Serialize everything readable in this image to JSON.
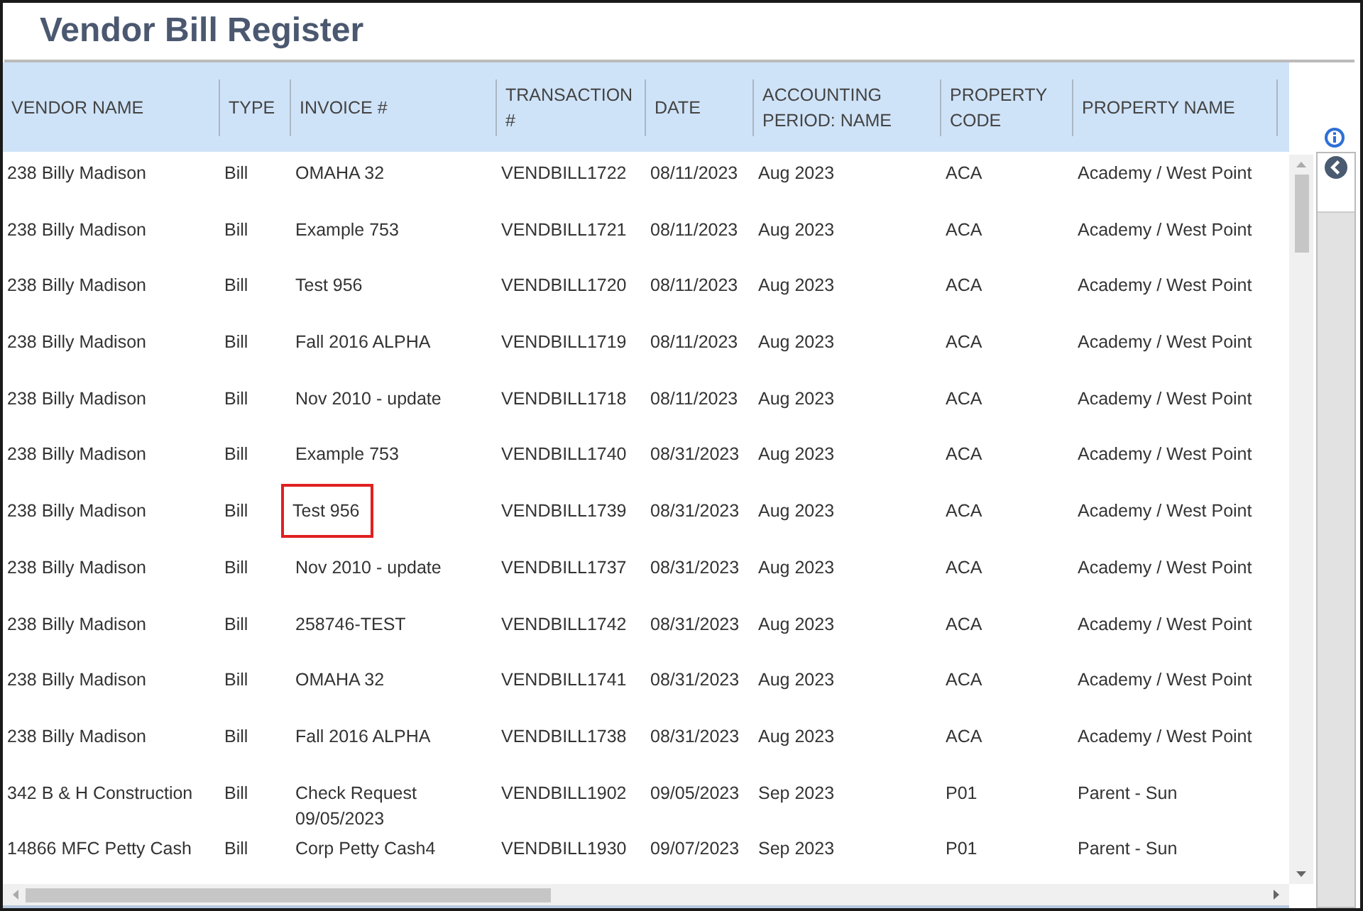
{
  "title": "Vendor Bill Register",
  "columns": [
    "VENDOR NAME",
    "TYPE",
    "INVOICE #",
    "TRANSACTION #",
    "DATE",
    "ACCOUNTING PERIOD: NAME",
    "PROPERTY CODE",
    "PROPERTY NAME"
  ],
  "rows": [
    {
      "cells": [
        "238 Billy Madison",
        "Bill",
        "OMAHA 32",
        "VENDBILL1722",
        "08/11/2023",
        "Aug 2023",
        "ACA",
        "Academy / West Point"
      ],
      "marked": false
    },
    {
      "cells": [
        "238 Billy Madison",
        "Bill",
        "Example 753",
        "VENDBILL1721",
        "08/11/2023",
        "Aug 2023",
        "ACA",
        "Academy / West Point"
      ],
      "marked": false
    },
    {
      "cells": [
        "238 Billy Madison",
        "Bill",
        "Test 956",
        "VENDBILL1720",
        "08/11/2023",
        "Aug 2023",
        "ACA",
        "Academy / West Point"
      ],
      "marked": false
    },
    {
      "cells": [
        "238 Billy Madison",
        "Bill",
        "Fall 2016 ALPHA",
        "VENDBILL1719",
        "08/11/2023",
        "Aug 2023",
        "ACA",
        "Academy / West Point"
      ],
      "marked": false
    },
    {
      "cells": [
        "238 Billy Madison",
        "Bill",
        "Nov 2010 - update",
        "VENDBILL1718",
        "08/11/2023",
        "Aug 2023",
        "ACA",
        "Academy / West Point"
      ],
      "marked": false
    },
    {
      "cells": [
        "238 Billy Madison",
        "Bill",
        "Example 753",
        "VENDBILL1740",
        "08/31/2023",
        "Aug 2023",
        "ACA",
        "Academy / West Point"
      ],
      "marked": false
    },
    {
      "cells": [
        "238 Billy Madison",
        "Bill",
        "Test 956",
        "VENDBILL1739",
        "08/31/2023",
        "Aug 2023",
        "ACA",
        "Academy / West Point"
      ],
      "marked": true
    },
    {
      "cells": [
        "238 Billy Madison",
        "Bill",
        "Nov 2010 - update",
        "VENDBILL1737",
        "08/31/2023",
        "Aug 2023",
        "ACA",
        "Academy / West Point"
      ],
      "marked": false
    },
    {
      "cells": [
        "238 Billy Madison",
        "Bill",
        "258746-TEST",
        "VENDBILL1742",
        "08/31/2023",
        "Aug 2023",
        "ACA",
        "Academy / West Point"
      ],
      "marked": false
    },
    {
      "cells": [
        "238 Billy Madison",
        "Bill",
        "OMAHA 32",
        "VENDBILL1741",
        "08/31/2023",
        "Aug 2023",
        "ACA",
        "Academy / West Point"
      ],
      "marked": false
    },
    {
      "cells": [
        "238 Billy Madison",
        "Bill",
        "Fall 2016 ALPHA",
        "VENDBILL1738",
        "08/31/2023",
        "Aug 2023",
        "ACA",
        "Academy / West Point"
      ],
      "marked": false
    },
    {
      "cells": [
        "342 B & H Construction",
        "Bill",
        "Check Request 09/05/2023",
        "VENDBILL1902",
        "09/05/2023",
        "Sep 2023",
        "P01",
        "Parent - Sun"
      ],
      "marked": false
    },
    {
      "cells": [
        "14866 MFC Petty Cash",
        "Bill",
        "Corp Petty Cash4",
        "VENDBILL1930",
        "09/07/2023",
        "Sep 2023",
        "P01",
        "Parent - Sun"
      ],
      "marked": false
    }
  ]
}
